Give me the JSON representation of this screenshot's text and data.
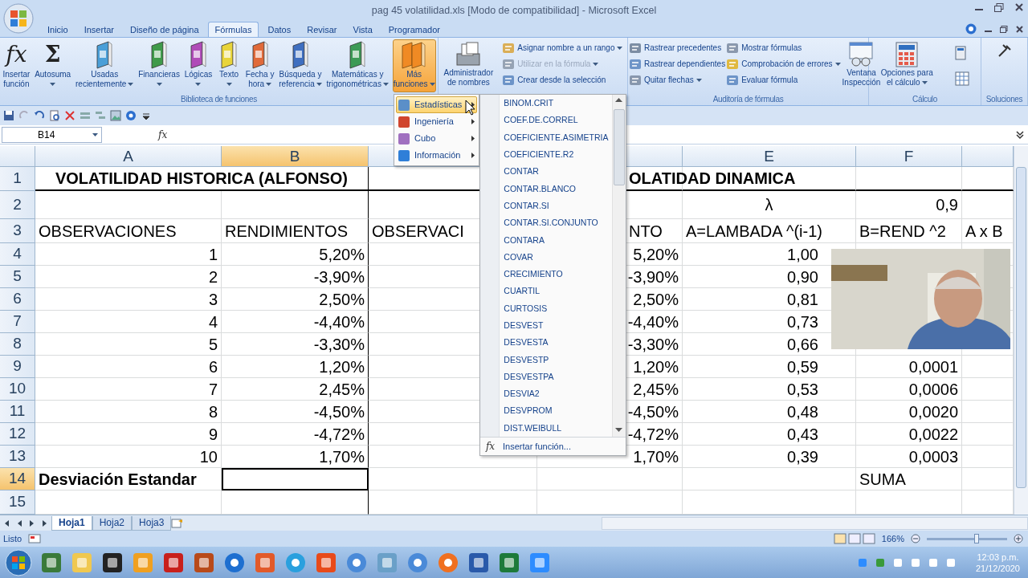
{
  "window": {
    "title": "pag 45 volatilidad.xls  [Modo de compatibilidad] - Microsoft Excel"
  },
  "ribbon_tabs": [
    {
      "label": "Inicio",
      "selected": false
    },
    {
      "label": "Insertar",
      "selected": false
    },
    {
      "label": "Diseño de página",
      "selected": false
    },
    {
      "label": "Fórmulas",
      "selected": true
    },
    {
      "label": "Datos",
      "selected": false
    },
    {
      "label": "Revisar",
      "selected": false
    },
    {
      "label": "Vista",
      "selected": false
    },
    {
      "label": "Programador",
      "selected": false
    }
  ],
  "ribbon_groups": [
    {
      "label": "Biblioteca de funciones",
      "items": [
        {
          "kind": "glyph",
          "glyph": "fx",
          "lines": [
            "Insertar",
            "función"
          ],
          "dropdown": false,
          "pressed": false
        },
        {
          "kind": "glyph",
          "glyph": "Σ",
          "lines": [
            "Autosuma"
          ],
          "dropdown": true,
          "pressed": false
        },
        {
          "kind": "book",
          "color": "#4a9fd8",
          "lines": [
            "Usadas",
            "recientemente"
          ],
          "dropdown": true,
          "pressed": false
        },
        {
          "kind": "book",
          "color": "#3f9a4a",
          "lines": [
            "Financieras"
          ],
          "dropdown": true,
          "pressed": false
        },
        {
          "kind": "book",
          "color": "#b04cb8",
          "lines": [
            "Lógicas"
          ],
          "dropdown": true,
          "pressed": false
        },
        {
          "kind": "book",
          "color": "#e8d43a",
          "lines": [
            "Texto"
          ],
          "dropdown": true,
          "pressed": false
        },
        {
          "kind": "book",
          "color": "#e06a3a",
          "lines": [
            "Fecha y",
            "hora"
          ],
          "dropdown": true,
          "pressed": false
        },
        {
          "kind": "book",
          "color": "#3f6fc0",
          "lines": [
            "Búsqueda y",
            "referencia"
          ],
          "dropdown": true,
          "pressed": false
        },
        {
          "kind": "book",
          "color": "#3c9a56",
          "lines": [
            "Matemáticas y",
            "trigonométricas"
          ],
          "dropdown": true,
          "pressed": false
        },
        {
          "kind": "books",
          "lines": [
            "Más",
            "funciones"
          ],
          "dropdown": true,
          "pressed": true
        }
      ]
    },
    {
      "items": [
        {
          "kind": "cards",
          "lines": [
            "Administrador",
            "de nombres"
          ],
          "dropdown": false,
          "pressed": false
        },
        {
          "kind": "stack",
          "items": [
            {
              "label": "Asignar nombre a un rango",
              "dropdown": true,
              "disabled": false
            },
            {
              "label": "Utilizar en la fórmula",
              "dropdown": true,
              "disabled": true
            },
            {
              "label": "Crear desde la selección",
              "dropdown": false,
              "disabled": false
            }
          ]
        }
      ]
    },
    {
      "label": "Auditoría de fórmulas",
      "items": [
        {
          "kind": "stack",
          "items": [
            {
              "label": "Rastrear precedentes",
              "dropdown": false,
              "disabled": false
            },
            {
              "label": "Rastrear dependientes",
              "dropdown": false,
              "disabled": false
            },
            {
              "label": "Quitar flechas",
              "dropdown": true,
              "disabled": false
            }
          ]
        },
        {
          "kind": "stack",
          "items": [
            {
              "label": "Mostrar fórmulas",
              "dropdown": false,
              "disabled": false
            },
            {
              "label": "Comprobación de errores",
              "dropdown": true,
              "disabled": false
            },
            {
              "label": "Evaluar fórmula",
              "dropdown": false,
              "disabled": false
            }
          ]
        },
        {
          "kind": "glasses",
          "lines": [
            "Ventana",
            "Inspección"
          ],
          "dropdown": false,
          "pressed": false
        }
      ]
    },
    {
      "label": "Cálculo",
      "items": [
        {
          "kind": "calculator",
          "lines": [
            "Opciones para",
            "el cálculo"
          ],
          "dropdown": true,
          "pressed": false
        },
        {
          "kind": "icons"
        }
      ]
    },
    {
      "label": "Soluciones",
      "items": [
        {
          "kind": "tool"
        }
      ]
    }
  ],
  "name_box": {
    "value": "B14"
  },
  "formula_bar": {
    "glyph": "fx"
  },
  "functions_menu": {
    "items": [
      {
        "label": "Estadísticas",
        "selected": true,
        "color": "#5b8fc8"
      },
      {
        "label": "Ingeniería",
        "selected": false,
        "color": "#d0452e"
      },
      {
        "label": "Cubo",
        "selected": false,
        "color": "#a070c0"
      },
      {
        "label": "Información",
        "selected": false,
        "color": "#2f7fd8"
      }
    ]
  },
  "statistics_submenu": {
    "items": [
      "BINOM.CRIT",
      "COEF.DE.CORREL",
      "COEFICIENTE.ASIMETRIA",
      "COEFICIENTE.R2",
      "CONTAR",
      "CONTAR.BLANCO",
      "CONTAR.SI",
      "CONTAR.SI.CONJUNTO",
      "CONTARA",
      "COVAR",
      "CRECIMIENTO",
      "CUARTIL",
      "CURTOSIS",
      "DESVEST",
      "DESVESTA",
      "DESVESTP",
      "DESVESTPA",
      "DESVIA2",
      "DESVPROM",
      "DIST.WEIBULL"
    ],
    "footer": {
      "glyph": "fx",
      "label": "Insertar función..."
    }
  },
  "sheet": {
    "columns": [
      {
        "label": "A",
        "selected": false
      },
      {
        "label": "B",
        "selected": true
      },
      {
        "selected": false
      },
      {
        "selected": false
      },
      {
        "label": "E",
        "selected": false
      },
      {
        "label": "F",
        "selected": false
      },
      {
        "selected": false
      }
    ],
    "rows": [
      {
        "number": "1",
        "selected": false,
        "cells": [
          {
            "text": "VOLATILIDAD HISTORICA (ALFONSO)",
            "bold": true,
            "merged": true
          },
          {},
          {},
          {
            "text": "OLATIDAD DINAMICA",
            "bold": true
          }
        ]
      },
      {
        "number": "2",
        "selected": false,
        "cells": [
          {},
          {},
          {},
          {},
          {
            "text": "λ"
          },
          {
            "text": "0,9"
          }
        ]
      },
      {
        "number": "3",
        "selected": false,
        "cells": [
          {
            "text": "OBSERVACIONES"
          },
          {
            "text": "RENDIMIENTOS"
          },
          {
            "text": "OBSERVACI"
          },
          {
            "text": "NTO"
          },
          {
            "text": "A=LAMBADA ^(i-1)"
          },
          {
            "text": "B=REND ^2"
          },
          {
            "text": "A x B"
          }
        ]
      },
      {
        "number": "4",
        "selected": false,
        "cells": [
          {
            "text": "1"
          },
          {
            "text": "5,20%"
          },
          {},
          {
            "text": "5,20%"
          },
          {
            "text": "1,00"
          }
        ]
      },
      {
        "number": "5",
        "selected": false,
        "cells": [
          {
            "text": "2"
          },
          {
            "text": "-3,90%"
          },
          {},
          {
            "text": "-3,90%"
          },
          {
            "text": "0,90"
          }
        ]
      },
      {
        "number": "6",
        "selected": false,
        "cells": [
          {
            "text": "3"
          },
          {
            "text": "2,50%"
          },
          {},
          {
            "text": "2,50%"
          },
          {
            "text": "0,81"
          }
        ]
      },
      {
        "number": "7",
        "selected": false,
        "cells": [
          {
            "text": "4"
          },
          {
            "text": "-4,40%"
          },
          {},
          {
            "text": "-4,40%"
          },
          {
            "text": "0,73"
          }
        ]
      },
      {
        "number": "8",
        "selected": false,
        "cells": [
          {
            "text": "5"
          },
          {
            "text": "-3,30%"
          },
          {},
          {
            "text": "-3,30%"
          },
          {
            "text": "0,66"
          }
        ]
      },
      {
        "number": "9",
        "selected": false,
        "cells": [
          {
            "text": "6"
          },
          {
            "text": "1,20%"
          },
          {},
          {
            "text": "1,20%"
          },
          {
            "text": "0,59"
          },
          {
            "text": "0,0001"
          }
        ]
      },
      {
        "number": "10",
        "selected": false,
        "cells": [
          {
            "text": "7"
          },
          {
            "text": "2,45%"
          },
          {},
          {
            "text": "2,45%"
          },
          {
            "text": "0,53"
          },
          {
            "text": "0,0006"
          }
        ]
      },
      {
        "number": "11",
        "selected": false,
        "cells": [
          {
            "text": "8"
          },
          {
            "text": "-4,50%"
          },
          {},
          {
            "text": "-4,50%"
          },
          {
            "text": "0,48"
          },
          {
            "text": "0,0020"
          }
        ]
      },
      {
        "number": "12",
        "selected": false,
        "cells": [
          {
            "text": "9"
          },
          {
            "text": "-4,72%"
          },
          {},
          {
            "text": "-4,72%"
          },
          {
            "text": "0,43"
          },
          {
            "text": "0,0022"
          }
        ]
      },
      {
        "number": "13",
        "selected": false,
        "cells": [
          {
            "text": "10"
          },
          {
            "text": "1,70%"
          },
          {},
          {
            "text": "1,70%"
          },
          {
            "text": "0,39"
          },
          {
            "text": "0,0003"
          }
        ]
      },
      {
        "number": "14",
        "selected": true,
        "cells": [
          {
            "text": "Desviación Estandar",
            "bold": true
          },
          {
            "selected": true
          },
          {},
          {},
          {},
          {
            "text": "SUMA"
          }
        ]
      },
      {
        "number": "15",
        "selected": false,
        "cells": []
      }
    ]
  },
  "sheet_tabs": [
    {
      "label": "Hoja1",
      "selected": true
    },
    {
      "label": "Hoja2",
      "selected": false
    },
    {
      "label": "Hoja3",
      "selected": false
    }
  ],
  "status_bar": {
    "status": "Listo",
    "zoom": "166%",
    "level": 0.62
  },
  "taskbar": {
    "time": "12:03 p.m.",
    "date": "21/12/2020"
  }
}
